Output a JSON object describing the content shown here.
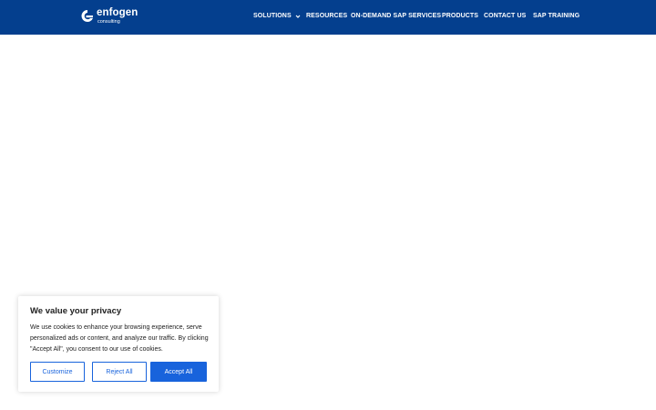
{
  "header": {
    "logo": {
      "name": "enfogen",
      "sub": "consulting"
    },
    "nav": [
      {
        "label": "SOLUTIONS",
        "has_dropdown": true
      },
      {
        "label": "RESOURCES",
        "has_dropdown": false
      },
      {
        "label": "ON-DEMAND SAP SERVICES",
        "has_dropdown": false
      },
      {
        "label": "PRODUCTS",
        "has_dropdown": false
      },
      {
        "label": "CONTACT US",
        "has_dropdown": false
      },
      {
        "label": "SAP TRAINING",
        "has_dropdown": false
      }
    ]
  },
  "cookie_banner": {
    "title": "We value your privacy",
    "text": "We use cookies to enhance your browsing experience, serve personalized ads or content, and analyze our traffic. By clicking \"Accept All\", you consent to our use of cookies.",
    "customize_label": "Customize",
    "reject_label": "Reject All",
    "accept_label": "Accept All"
  },
  "colors": {
    "header_bg": "#043f8e",
    "accent": "#1863dc"
  }
}
